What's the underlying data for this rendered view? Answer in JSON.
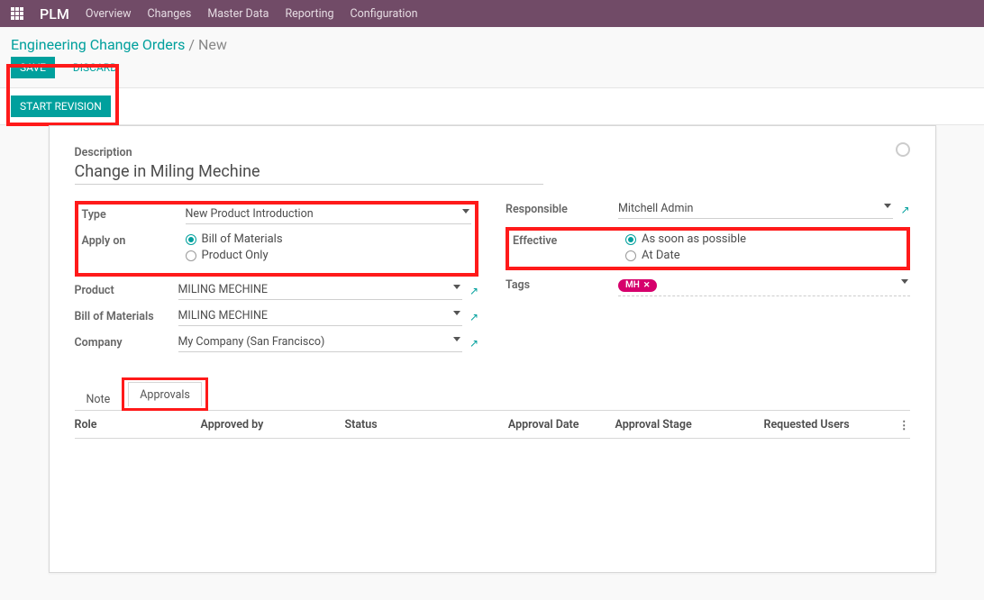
{
  "nav": {
    "brand": "PLM",
    "items": [
      "Overview",
      "Changes",
      "Master Data",
      "Reporting",
      "Configuration"
    ]
  },
  "breadcrumb": {
    "root": "Engineering Change Orders",
    "sep": "/",
    "current": "New"
  },
  "actions": {
    "save": "Save",
    "discard": "Discard",
    "start_revision": "Start Revision"
  },
  "form": {
    "description_label": "Description",
    "description_value": "Change in Miling Mechine",
    "left": {
      "type_label": "Type",
      "type_value": "New Product Introduction",
      "apply_on_label": "Apply on",
      "apply_on_opts": [
        "Bill of Materials",
        "Product Only"
      ],
      "product_label": "Product",
      "product_value": "MILING MECHINE",
      "bom_label": "Bill of Materials",
      "bom_value": "MILING MECHINE",
      "company_label": "Company",
      "company_value": "My Company (San Francisco)"
    },
    "right": {
      "responsible_label": "Responsible",
      "responsible_value": "Mitchell Admin",
      "effective_label": "Effective",
      "effective_opts": [
        "As soon as possible",
        "At Date"
      ],
      "tags_label": "Tags",
      "tag_value": "MH"
    }
  },
  "tabs": {
    "note": "Note",
    "approvals": "Approvals"
  },
  "grid": {
    "role": "Role",
    "approved_by": "Approved by",
    "status": "Status",
    "approval_date": "Approval Date",
    "approval_stage": "Approval Stage",
    "requested_users": "Requested Users"
  },
  "glyphs": {
    "ext": "↗",
    "x": "✕",
    "dots": "⋮"
  }
}
